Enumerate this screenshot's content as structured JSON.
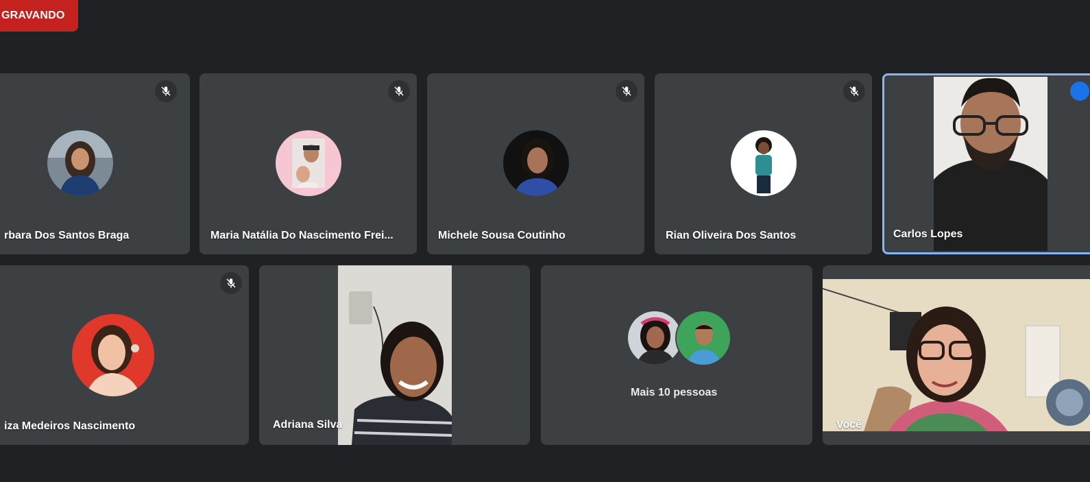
{
  "recording": {
    "label": "GRAVANDO"
  },
  "participants": [
    {
      "name": "rbara Dos Santos Braga",
      "muted": true,
      "icon": "mic-off-icon"
    },
    {
      "name": "Maria Natália Do Nascimento Frei...",
      "muted": true,
      "icon": "mic-off-icon"
    },
    {
      "name": "Michele Sousa Coutinho",
      "muted": true,
      "icon": "mic-off-icon"
    },
    {
      "name": "Rian Oliveira Dos Santos",
      "muted": true,
      "icon": "mic-off-icon"
    },
    {
      "name": "Carlos Lopes",
      "muted": false,
      "active_speaker": true
    },
    {
      "name": "iza Medeiros Nascimento",
      "muted": true,
      "icon": "mic-off-icon"
    },
    {
      "name": "Adriana Silva",
      "muted": false
    },
    {
      "name": "Você",
      "muted": false
    }
  ],
  "more": {
    "label": "Mais 10 pessoas"
  },
  "colors": {
    "background": "#202124",
    "tile": "#3c4043",
    "recording": "#c5221f",
    "active_outline": "#8ab4f8"
  }
}
